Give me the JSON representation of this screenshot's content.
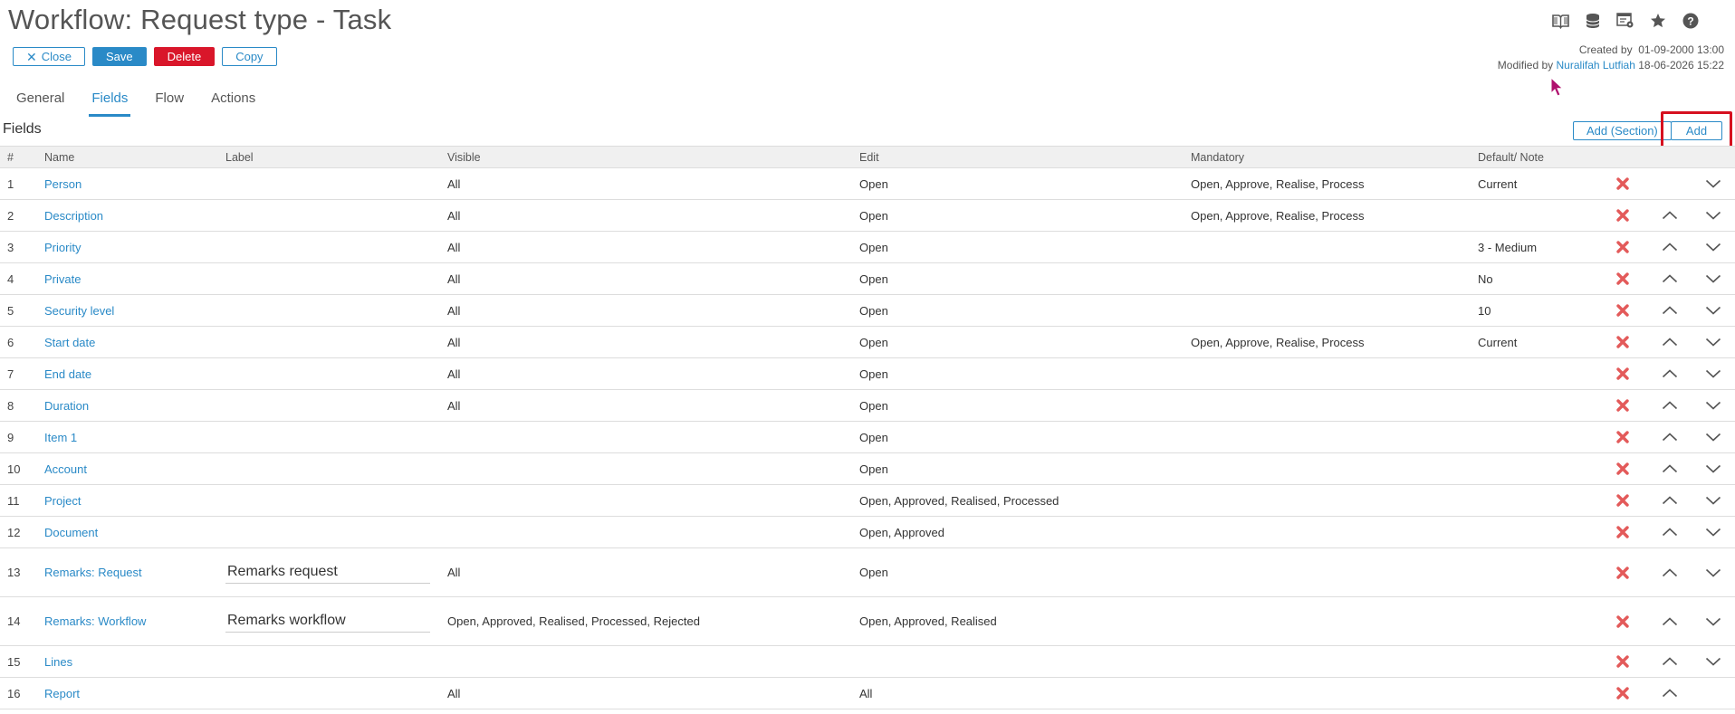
{
  "page": {
    "title": "Workflow: Request type - Task"
  },
  "toolbar": {
    "close_label": "Close",
    "save_label": "Save",
    "delete_label": "Delete",
    "copy_label": "Copy"
  },
  "top_icons": [
    "book-icon",
    "database-icon",
    "settings-window-icon",
    "star-icon",
    "help-icon"
  ],
  "meta": {
    "created_label": "Created by",
    "created_date": "01-09-2000 13:00",
    "modified_label": "Modified by",
    "modified_user": "Nuralifah Lutfiah",
    "modified_date": "18-06-2026 15:22"
  },
  "tabs": [
    {
      "label": "General",
      "active": false
    },
    {
      "label": "Fields",
      "active": true
    },
    {
      "label": "Flow",
      "active": false
    },
    {
      "label": "Actions",
      "active": false
    }
  ],
  "section": {
    "title": "Fields",
    "add_section_label": "Add (Section)",
    "add_label": "Add"
  },
  "columns": {
    "num": "#",
    "name": "Name",
    "label": "Label",
    "visible": "Visible",
    "edit": "Edit",
    "mandatory": "Mandatory",
    "default": "Default/ Note"
  },
  "colors": {
    "accent": "#2a8ac7",
    "danger": "#d9162a",
    "delete_x": "#e35a5a",
    "highlight_box": "#d6101f"
  },
  "rows": [
    {
      "num": "1",
      "name": "Person",
      "label": "",
      "visible": "All",
      "edit": "Open",
      "mandatory": "Open, Approve, Realise, Process",
      "default": "Current",
      "up": false,
      "down": true
    },
    {
      "num": "2",
      "name": "Description",
      "label": "",
      "visible": "All",
      "edit": "Open",
      "mandatory": "Open, Approve, Realise, Process",
      "default": "",
      "up": true,
      "down": true
    },
    {
      "num": "3",
      "name": "Priority",
      "label": "",
      "visible": "All",
      "edit": "Open",
      "mandatory": "",
      "default": "3 - Medium",
      "up": true,
      "down": true
    },
    {
      "num": "4",
      "name": "Private",
      "label": "",
      "visible": "All",
      "edit": "Open",
      "mandatory": "",
      "default": "No",
      "up": true,
      "down": true
    },
    {
      "num": "5",
      "name": "Security level",
      "label": "",
      "visible": "All",
      "edit": "Open",
      "mandatory": "",
      "default": "10",
      "up": true,
      "down": true
    },
    {
      "num": "6",
      "name": "Start date",
      "label": "",
      "visible": "All",
      "edit": "Open",
      "mandatory": "Open, Approve, Realise, Process",
      "default": "Current",
      "up": true,
      "down": true
    },
    {
      "num": "7",
      "name": "End date",
      "label": "",
      "visible": "All",
      "edit": "Open",
      "mandatory": "",
      "default": "",
      "up": true,
      "down": true
    },
    {
      "num": "8",
      "name": "Duration",
      "label": "",
      "visible": "All",
      "edit": "Open",
      "mandatory": "",
      "default": "",
      "up": true,
      "down": true
    },
    {
      "num": "9",
      "name": "Item 1",
      "label": "",
      "visible": "",
      "edit": "Open",
      "mandatory": "",
      "default": "",
      "up": true,
      "down": true
    },
    {
      "num": "10",
      "name": "Account",
      "label": "",
      "visible": "",
      "edit": "Open",
      "mandatory": "",
      "default": "",
      "up": true,
      "down": true
    },
    {
      "num": "11",
      "name": "Project",
      "label": "",
      "visible": "",
      "edit": "Open, Approved, Realised, Processed",
      "mandatory": "",
      "default": "",
      "up": true,
      "down": true
    },
    {
      "num": "12",
      "name": "Document",
      "label": "",
      "visible": "",
      "edit": "Open, Approved",
      "mandatory": "",
      "default": "",
      "up": true,
      "down": true
    },
    {
      "num": "13",
      "name": "Remarks: Request",
      "label": "Remarks request",
      "visible": "All",
      "edit": "Open",
      "mandatory": "",
      "default": "",
      "up": true,
      "down": true
    },
    {
      "num": "14",
      "name": "Remarks: Workflow",
      "label": "Remarks workflow",
      "visible": "Open, Approved, Realised, Processed, Rejected",
      "edit": "Open, Approved, Realised",
      "mandatory": "",
      "default": "",
      "up": true,
      "down": true
    },
    {
      "num": "15",
      "name": "Lines",
      "label": "",
      "visible": "",
      "edit": "",
      "mandatory": "",
      "default": "",
      "up": true,
      "down": true
    },
    {
      "num": "16",
      "name": "Report",
      "label": "",
      "visible": "All",
      "edit": "All",
      "mandatory": "",
      "default": "",
      "up": true,
      "down": false
    }
  ]
}
